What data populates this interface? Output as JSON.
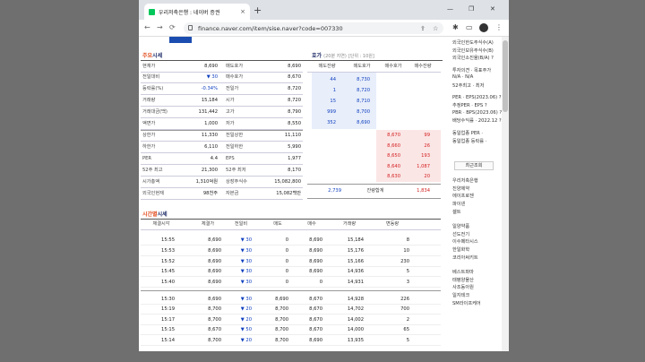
{
  "browser": {
    "tab_title": "우리저축은행 : 네이버 증권",
    "tab_close": "×",
    "new_tab": "+",
    "minimize": "—",
    "maximize": "❐",
    "close": "✕",
    "back": "←",
    "forward": "→",
    "reload": "⟳",
    "url": "finance.naver.com/item/sise.naver?code=007330",
    "icons": [
      "lock-icon",
      "share-icon",
      "star-icon",
      "extensions-icon",
      "sidebar-icon",
      "profile-icon",
      "menu-icon"
    ]
  },
  "quote": {
    "title_prefix": "주요",
    "title_suffix": "시세",
    "left": [
      {
        "label": "현재가",
        "value": "8,690"
      },
      {
        "label": "전일대비",
        "value": "▼ 30"
      },
      {
        "label": "등락률(%)",
        "value": "-0.34%"
      },
      {
        "label": "거래량",
        "value": "15,184"
      },
      {
        "label": "거래대금(백)",
        "value": "131,442"
      },
      {
        "label": "액면가",
        "value": "1,000"
      },
      {
        "label": "상한가",
        "value": "11,330"
      },
      {
        "label": "하한가",
        "value": "6,110"
      },
      {
        "label": "PER",
        "value": "4.4"
      },
      {
        "label": "52주 최고",
        "value": "21,300"
      },
      {
        "label": "시가총액",
        "value": "1,310억원"
      },
      {
        "label": "외국인현재",
        "value": "98천주"
      }
    ],
    "right": [
      {
        "label": "매도호가",
        "value": "8,690"
      },
      {
        "label": "매수호가",
        "value": "8,670"
      },
      {
        "label": "전일가",
        "value": "8,720"
      },
      {
        "label": "시가",
        "value": "8,720"
      },
      {
        "label": "고가",
        "value": "8,790"
      },
      {
        "label": "저가",
        "value": "8,550"
      },
      {
        "label": "전일상한",
        "value": "11,110"
      },
      {
        "label": "전일하한",
        "value": "5,990"
      },
      {
        "label": "EPS",
        "value": "1,977"
      },
      {
        "label": "52주 최저",
        "value": "8,170"
      },
      {
        "label": "상장주식수",
        "value": "15,082,800"
      },
      {
        "label": "자본금",
        "value": "15,082백만"
      }
    ]
  },
  "orderbook": {
    "title": "호가",
    "subtitle": "(20분 지연)",
    "unit": "[단위 : 10원]",
    "headers": [
      "매도잔량",
      "매도호가",
      "매수호가",
      "매수잔량"
    ],
    "asks": [
      {
        "qty": "44",
        "price": "8,730"
      },
      {
        "qty": "1",
        "price": "8,720"
      },
      {
        "qty": "15",
        "price": "8,710"
      },
      {
        "qty": "999",
        "price": "8,700"
      },
      {
        "qty": "352",
        "price": "8,690"
      }
    ],
    "bids": [
      {
        "price": "8,670",
        "qty": "99"
      },
      {
        "price": "8,660",
        "qty": "26"
      },
      {
        "price": "8,650",
        "qty": "193"
      },
      {
        "price": "8,640",
        "qty": "1,087"
      },
      {
        "price": "8,630",
        "qty": "20"
      }
    ],
    "total_ask": "2,739",
    "total_label": "잔량합계",
    "total_bid": "1,834"
  },
  "timeseries": {
    "title_prefix": "시간별",
    "title_suffix": "시세",
    "headers": [
      "체결시각",
      "체결가",
      "전일비",
      "매도",
      "매수",
      "거래량",
      "변동량"
    ],
    "rows": [
      [
        "15:55",
        "8,690",
        "▼ 30",
        "0",
        "8,690",
        "15,184",
        "8"
      ],
      [
        "15:53",
        "8,690",
        "▼ 30",
        "0",
        "8,690",
        "15,176",
        "10"
      ],
      [
        "15:52",
        "8,690",
        "▼ 30",
        "0",
        "8,690",
        "15,166",
        "230"
      ],
      [
        "15:45",
        "8,690",
        "▼ 30",
        "0",
        "8,690",
        "14,936",
        "5"
      ],
      [
        "15:40",
        "8,690",
        "▼ 30",
        "0",
        "0",
        "14,931",
        "3"
      ],
      [
        "15:30",
        "8,690",
        "▼ 30",
        "8,690",
        "8,670",
        "14,928",
        "226"
      ],
      [
        "15:19",
        "8,700",
        "▼ 20",
        "8,700",
        "8,670",
        "14,702",
        "700"
      ],
      [
        "15:17",
        "8,700",
        "▼ 20",
        "8,700",
        "8,670",
        "14,002",
        "2"
      ],
      [
        "15:15",
        "8,670",
        "▼ 50",
        "8,700",
        "8,670",
        "14,000",
        "65"
      ],
      [
        "15:14",
        "8,700",
        "▼ 20",
        "8,700",
        "8,690",
        "13,935",
        "5"
      ]
    ]
  },
  "sidebar": {
    "top": [
      "외국인한도주식수(A)",
      "외국인보유주식수(B)",
      "외국인소진율(B/A) ?",
      "",
      "투자의견 · 목표주가",
      "N/A · N/A",
      "52주최고 · 최저",
      "",
      "PER · EPS(2023.06) ?",
      "추정PER · EPS ?",
      "PBR · BPS(2023.06) ?",
      "배당수익률 · 2022.12 ?",
      "",
      "동일업종 PER ·",
      "동일업종 등락률 ·"
    ],
    "recent_button": "최근조회",
    "recent": [
      "우리저축은행",
      "진양제약",
      "에이프로젠",
      "파이넨",
      "셀트",
      "",
      "일양약품",
      "선도전기",
      "이수페타시스",
      "한일화학",
      "코리아써키트",
      "",
      "베스트파마",
      "태평양물산",
      "사조동아원",
      "일지테크",
      "SM라이프케어"
    ]
  }
}
